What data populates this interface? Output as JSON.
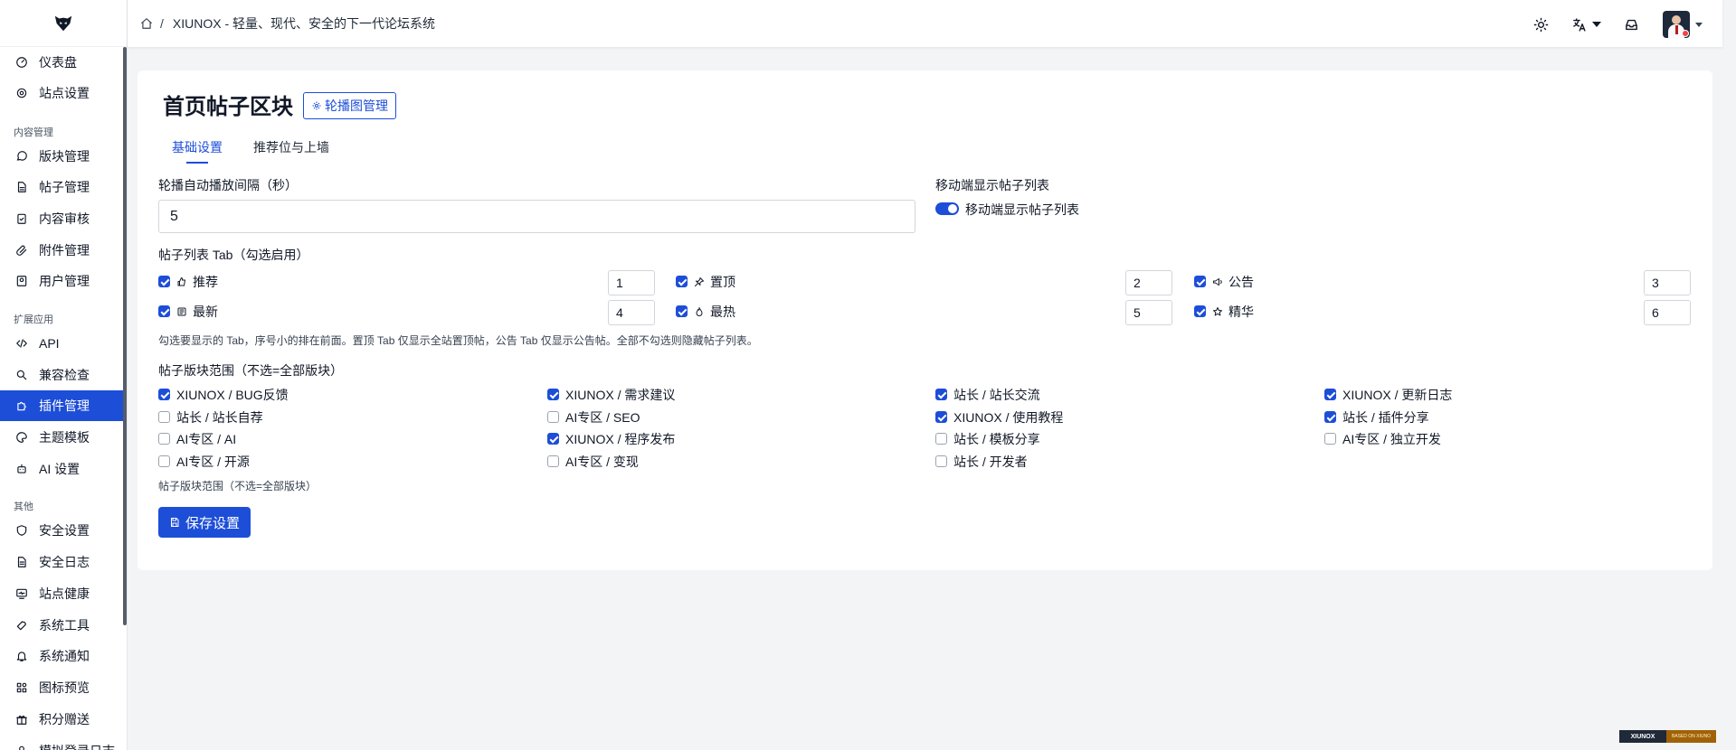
{
  "header": {
    "separator": "/",
    "title": "XIUNOX - 轻量、现代、安全的下一代论坛系统"
  },
  "sidebar": {
    "items": [
      {
        "label": "仪表盘",
        "icon": "dashboard-icon"
      },
      {
        "label": "站点设置",
        "icon": "gear-icon"
      },
      {
        "label": "版块管理",
        "icon": "chat-bubble-icon"
      },
      {
        "label": "帖子管理",
        "icon": "document-icon"
      },
      {
        "label": "内容审核",
        "icon": "clipboard-check-icon"
      },
      {
        "label": "附件管理",
        "icon": "paperclip-icon"
      },
      {
        "label": "用户管理",
        "icon": "user-card-icon"
      },
      {
        "label": "API",
        "icon": "code-icon"
      },
      {
        "label": "兼容检查",
        "icon": "search-icon"
      },
      {
        "label": "插件管理",
        "icon": "puzzle-icon"
      },
      {
        "label": "主题模板",
        "icon": "palette-icon"
      },
      {
        "label": "AI 设置",
        "icon": "robot-icon"
      },
      {
        "label": "安全设置",
        "icon": "shield-icon"
      },
      {
        "label": "安全日志",
        "icon": "log-icon"
      },
      {
        "label": "站点健康",
        "icon": "monitor-heart-icon"
      },
      {
        "label": "系统工具",
        "icon": "wrench-icon"
      },
      {
        "label": "系统通知",
        "icon": "bell-icon"
      },
      {
        "label": "图标预览",
        "icon": "shapes-icon"
      },
      {
        "label": "积分赠送",
        "icon": "gift-icon"
      },
      {
        "label": "模拟登录日志",
        "icon": "user-icon"
      }
    ],
    "groups": [
      "内容管理",
      "扩展应用",
      "其他"
    ],
    "active": "插件管理"
  },
  "page": {
    "title": "首页帖子区块",
    "carousel_button": "轮播图管理",
    "tabs": [
      {
        "label": "基础设置",
        "active": true
      },
      {
        "label": "推荐位与上墙",
        "active": false
      }
    ],
    "interval_label": "轮播自动播放间隔（秒）",
    "interval_value": "5",
    "mobile_label": "移动端显示帖子列表",
    "mobile_toggle_label": "移动端显示帖子列表",
    "mobile_enabled": true,
    "tab_list_label": "帖子列表 Tab（勾选启用）",
    "tab_items": [
      {
        "label": "推荐",
        "icon": "thumbs-up-icon",
        "checked": true,
        "order": "1"
      },
      {
        "label": "置顶",
        "icon": "pin-icon",
        "checked": true,
        "order": "2"
      },
      {
        "label": "公告",
        "icon": "megaphone-icon",
        "checked": true,
        "order": "3"
      },
      {
        "label": "最新",
        "icon": "newspaper-icon",
        "checked": true,
        "order": "4"
      },
      {
        "label": "最热",
        "icon": "flame-icon",
        "checked": true,
        "order": "5"
      },
      {
        "label": "精华",
        "icon": "star-icon",
        "checked": true,
        "order": "6"
      }
    ],
    "tab_hint": "勾选要显示的 Tab，序号小的排在前面。置顶 Tab 仅显示全站置顶帖，公告 Tab 仅显示公告帖。全部不勾选则隐藏帖子列表。",
    "board_label": "帖子版块范围（不选=全部版块）",
    "boards": [
      {
        "label": "XIUNOX / BUG反馈",
        "checked": true
      },
      {
        "label": "XIUNOX / 需求建议",
        "checked": true
      },
      {
        "label": "站长 / 站长交流",
        "checked": true
      },
      {
        "label": "XIUNOX / 更新日志",
        "checked": true
      },
      {
        "label": "站长 / 站长自荐",
        "checked": false
      },
      {
        "label": "AI专区 / SEO",
        "checked": false
      },
      {
        "label": "XIUNOX / 使用教程",
        "checked": true
      },
      {
        "label": "站长 / 插件分享",
        "checked": true
      },
      {
        "label": "AI专区 / AI",
        "checked": false
      },
      {
        "label": "XIUNOX / 程序发布",
        "checked": true
      },
      {
        "label": "站长 / 模板分享",
        "checked": false
      },
      {
        "label": "AI专区 / 独立开发",
        "checked": false
      },
      {
        "label": "AI专区 / 开源",
        "checked": false
      },
      {
        "label": "AI专区 / 变现",
        "checked": false
      },
      {
        "label": "站长 / 开发者",
        "checked": false
      }
    ],
    "board_hint": "帖子版块范围（不选=全部版块）",
    "save_button": "保存设置"
  },
  "footer": {
    "badge_left": "XIUNOX",
    "badge_right": "BASED ON XIUNO"
  },
  "colors": {
    "accent": "#1d4ed8",
    "background": "#f3f4f6",
    "sidebar_active": "#1d4ed8"
  }
}
